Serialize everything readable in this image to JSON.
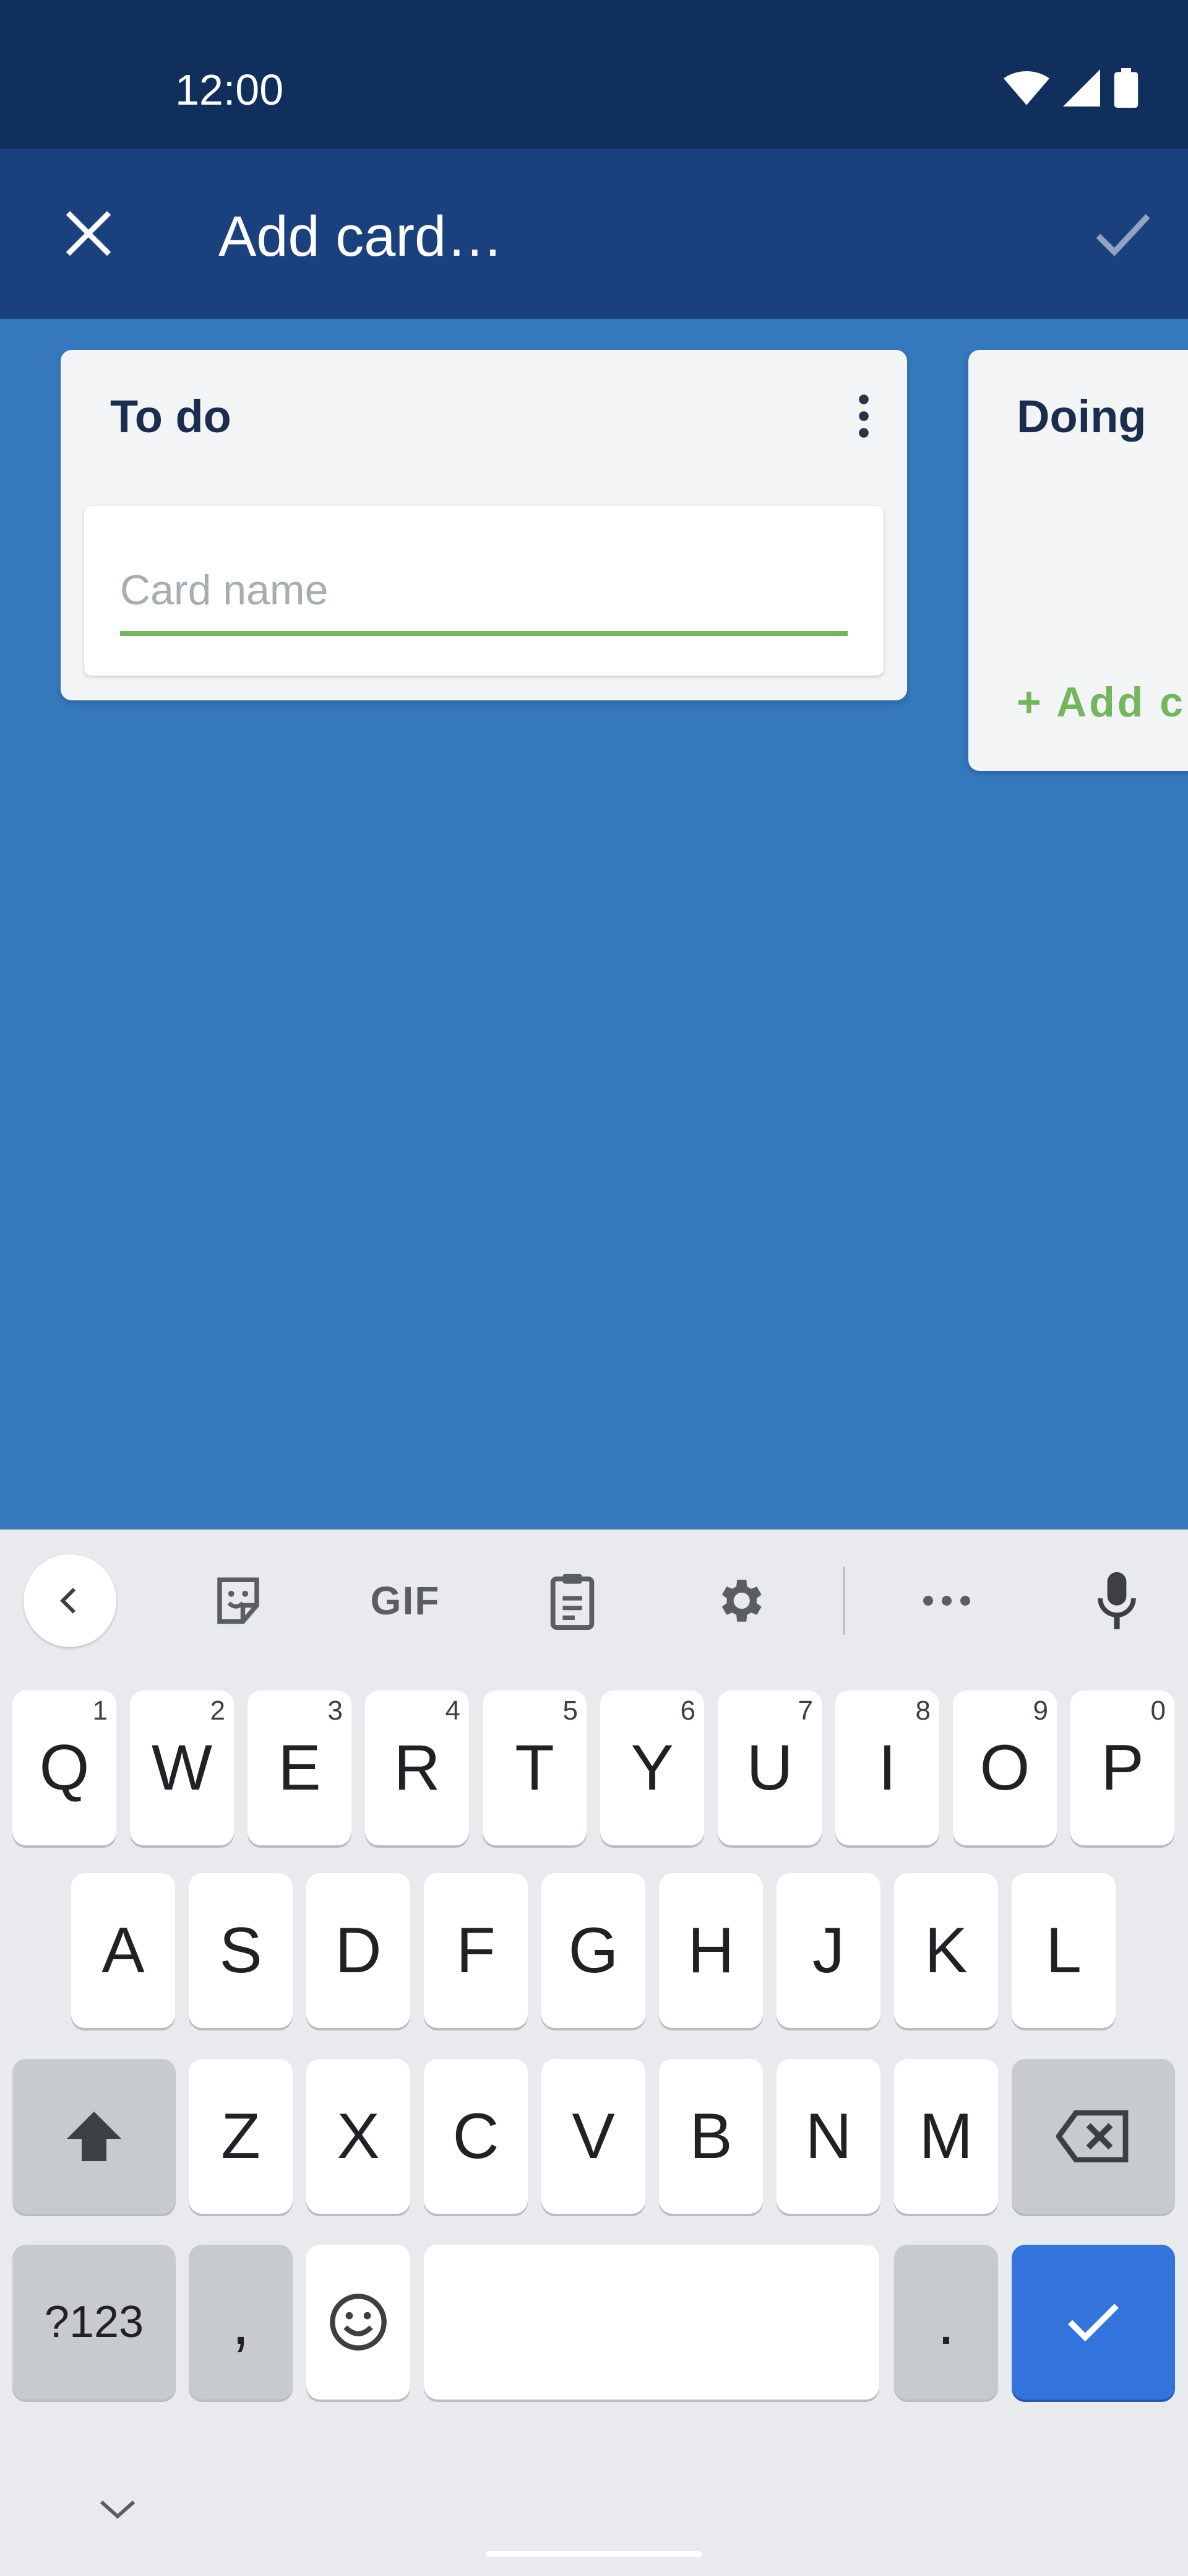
{
  "status_bar": {
    "time": "12:00",
    "icons": [
      "wifi-icon",
      "signal-icon",
      "battery-icon"
    ]
  },
  "app_bar": {
    "title": "Add card…",
    "close_icon": "close-icon",
    "confirm_icon": "check-icon"
  },
  "lists": [
    {
      "title": "To do",
      "menu_icon": "more-vertical-icon",
      "input": {
        "placeholder": "Card name",
        "value": ""
      }
    },
    {
      "title": "Doing",
      "add_label": "+ Add c"
    }
  ],
  "keyboard": {
    "toolbar": [
      "chevron-left-icon",
      "sticker-icon",
      "gif",
      "clipboard-icon",
      "gear-icon",
      "more-horizontal-icon",
      "microphone-icon"
    ],
    "gif_label": "GIF",
    "row1": [
      {
        "label": "Q",
        "hint": "1"
      },
      {
        "label": "W",
        "hint": "2"
      },
      {
        "label": "E",
        "hint": "3"
      },
      {
        "label": "R",
        "hint": "4"
      },
      {
        "label": "T",
        "hint": "5"
      },
      {
        "label": "Y",
        "hint": "6"
      },
      {
        "label": "U",
        "hint": "7"
      },
      {
        "label": "I",
        "hint": "8"
      },
      {
        "label": "O",
        "hint": "9"
      },
      {
        "label": "P",
        "hint": "0"
      }
    ],
    "row2": [
      "A",
      "S",
      "D",
      "F",
      "G",
      "H",
      "J",
      "K",
      "L"
    ],
    "row3": [
      "Z",
      "X",
      "C",
      "V",
      "B",
      "N",
      "M"
    ],
    "row4": {
      "symbols": "?123",
      "comma": ",",
      "period": "."
    }
  },
  "colors": {
    "status_bar": "#112f5c",
    "app_bar": "#1a407d",
    "board_bg": "#3578bd",
    "accent_green": "#74b65d",
    "enter_key": "#3273dc"
  }
}
